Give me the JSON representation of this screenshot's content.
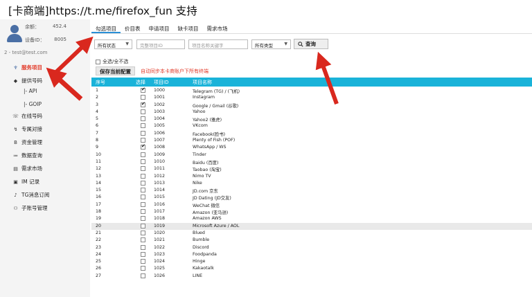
{
  "header": {
    "brand": "[卡商端]",
    "url": "https://t.me/firefox_fun",
    "support": "支持"
  },
  "account": {
    "balance_label": "余额：",
    "balance_value": "452.4",
    "device_label": "设备ID：",
    "device_value": "8005",
    "user": "2 - test@test.com"
  },
  "sidebar": {
    "items": [
      {
        "label": "服务项目",
        "icon": "service-icon",
        "active": true
      },
      {
        "label": "提供号码",
        "icon": "provide-icon"
      },
      {
        "label": "|- API",
        "sub": true
      },
      {
        "label": "|- GOIP",
        "sub": true
      },
      {
        "label": "在线号码",
        "icon": "phone-icon"
      },
      {
        "label": "专属对接",
        "icon": "link-icon"
      },
      {
        "label": "资金管理",
        "icon": "money-icon"
      },
      {
        "label": "数据查询",
        "icon": "data-icon"
      },
      {
        "label": "需求市场",
        "icon": "market-icon"
      },
      {
        "label": "IM 记录",
        "icon": "chat-icon"
      },
      {
        "label": "TG消息订阅",
        "icon": "bell-icon"
      },
      {
        "label": "子账号管理",
        "icon": "users-icon"
      }
    ]
  },
  "tabs": [
    "勾选项目",
    "价目表",
    "申请项目",
    "缺卡项目",
    "需求市场"
  ],
  "filters": {
    "status": "所有状态",
    "project_id_placeholder": "完整项目ID",
    "project_name_placeholder": "项目名称关键字",
    "type": "所有类型",
    "query_label": "查询"
  },
  "check_all_label": "全选/全不选",
  "save_label": "保存当前配置",
  "sync_note": "自动同步本卡商账户下所有终端",
  "table": {
    "headers": [
      "序号",
      "选择",
      "项目ID",
      "项目名称"
    ],
    "rows": [
      {
        "n": "1",
        "checked": true,
        "id": "1000",
        "name": "Telegram (TG) / (飞机)"
      },
      {
        "n": "2",
        "checked": false,
        "id": "1001",
        "name": "Instagram"
      },
      {
        "n": "3",
        "checked": true,
        "id": "1002",
        "name": "Google / Gmail (谷歌)"
      },
      {
        "n": "4",
        "checked": false,
        "id": "1003",
        "name": "Yahoo"
      },
      {
        "n": "5",
        "checked": false,
        "id": "1004",
        "name": "Yahoo2 (雅虎)"
      },
      {
        "n": "6",
        "checked": false,
        "id": "1005",
        "name": "VKcom"
      },
      {
        "n": "7",
        "checked": false,
        "id": "1006",
        "name": "Facebook(脸书)"
      },
      {
        "n": "8",
        "checked": false,
        "id": "1007",
        "name": "Plenty of Fish (POF)"
      },
      {
        "n": "9",
        "checked": true,
        "id": "1008",
        "name": "WhatsApp / WS"
      },
      {
        "n": "10",
        "checked": false,
        "id": "1009",
        "name": "Tinder"
      },
      {
        "n": "11",
        "checked": false,
        "id": "1010",
        "name": "Baidu (百度)"
      },
      {
        "n": "12",
        "checked": false,
        "id": "1011",
        "name": "Taobao (淘宝)"
      },
      {
        "n": "13",
        "checked": false,
        "id": "1012",
        "name": "Nimo TV"
      },
      {
        "n": "14",
        "checked": false,
        "id": "1013",
        "name": "Nike"
      },
      {
        "n": "15",
        "checked": false,
        "id": "1014",
        "name": "JD.com 京东"
      },
      {
        "n": "16",
        "checked": false,
        "id": "1015",
        "name": "JD Dating (JD交友)"
      },
      {
        "n": "17",
        "checked": false,
        "id": "1016",
        "name": "WeChat 微信"
      },
      {
        "n": "18",
        "checked": false,
        "id": "1017",
        "name": "Amazon (亚马逊)"
      },
      {
        "n": "19",
        "checked": false,
        "id": "1018",
        "name": "Amazon AWS"
      },
      {
        "n": "20",
        "checked": false,
        "id": "1019",
        "name": "Microsoft Azure / AOL"
      },
      {
        "n": "21",
        "checked": false,
        "id": "1020",
        "name": "Blued"
      },
      {
        "n": "22",
        "checked": false,
        "id": "1021",
        "name": "Bumble"
      },
      {
        "n": "23",
        "checked": false,
        "id": "1022",
        "name": "Discord"
      },
      {
        "n": "24",
        "checked": false,
        "id": "1023",
        "name": "Foodpanda"
      },
      {
        "n": "25",
        "checked": false,
        "id": "1024",
        "name": "Hinge"
      },
      {
        "n": "26",
        "checked": false,
        "id": "1025",
        "name": "Kakaotalk"
      },
      {
        "n": "27",
        "checked": false,
        "id": "1026",
        "name": "LINE"
      }
    ]
  },
  "colors": {
    "accent": "#1ab3d9",
    "active": "#e23b2a",
    "arrow": "#d9281e"
  }
}
